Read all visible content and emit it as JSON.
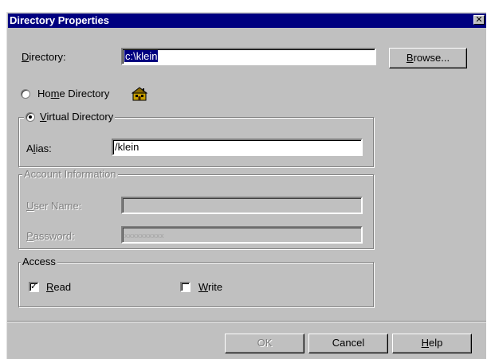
{
  "window": {
    "title": "Directory Properties",
    "close_glyph": "✕"
  },
  "directory": {
    "label_prefix": "",
    "label_accel": "D",
    "label_rest": "irectory:",
    "value": "c:\\klein"
  },
  "browse_button": {
    "accel": "B",
    "rest": "rowse..."
  },
  "home_directory": {
    "pre": "Ho",
    "accel": "m",
    "post": "e Directory",
    "selected": false,
    "icon": "home-directory-icon"
  },
  "virtual_directory": {
    "accel": "V",
    "rest": "irtual Directory",
    "selected": true
  },
  "alias": {
    "pre": "A",
    "accel": "l",
    "post": "ias:",
    "value": "/klein"
  },
  "account": {
    "legend": "Account Information",
    "username": {
      "accel": "U",
      "rest": "ser Name:",
      "value": ""
    },
    "password": {
      "accel": "P",
      "rest": "assword:",
      "value": "xxxxxxxxxx"
    }
  },
  "access": {
    "legend": "Access",
    "read": {
      "accel": "R",
      "rest": "ead",
      "checked": true,
      "check_glyph": "✓"
    },
    "write": {
      "accel": "W",
      "rest": "rite",
      "checked": false
    }
  },
  "buttons": {
    "ok": "OK",
    "cancel": "Cancel",
    "help_accel": "H",
    "help_rest": "elp"
  }
}
